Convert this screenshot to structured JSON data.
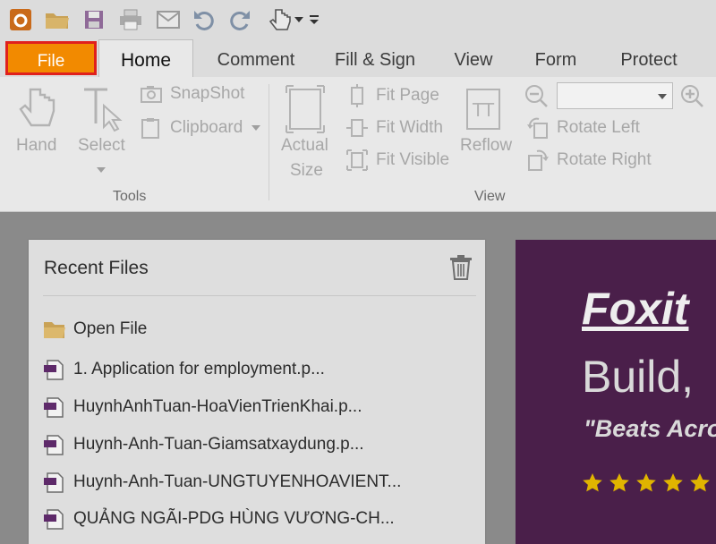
{
  "tabs": {
    "file": "File",
    "home": "Home",
    "comment": "Comment",
    "fill_sign": "Fill & Sign",
    "view": "View",
    "form": "Form",
    "protect": "Protect"
  },
  "ribbon": {
    "hand": "Hand",
    "select": "Select",
    "snapshot": "SnapShot",
    "clipboard": "Clipboard",
    "tools_group": "Tools",
    "actual_size_1": "Actual",
    "actual_size_2": "Size",
    "fit_page": "Fit Page",
    "fit_width": "Fit Width",
    "fit_visible": "Fit Visible",
    "reflow": "Reflow",
    "rotate_left": "Rotate Left",
    "rotate_right": "Rotate Right",
    "view_group": "View",
    "zoom_value": ""
  },
  "recent": {
    "title": "Recent Files",
    "open_file": "Open File",
    "files": [
      "1. Application for employment.p...",
      "HuynhAnhTuan-HoaVienTrienKhai.p...",
      "Huynh-Anh-Tuan-Giamsatxaydung.p...",
      "Huynh-Anh-Tuan-UNGTUYENHOAVIENT...",
      "QUẢNG NGÃI-PDG HÙNG VƯƠNG-CH..."
    ]
  },
  "promo": {
    "brand": "Foxit",
    "headline": "Build,",
    "quote": "\"Beats Acro"
  },
  "colors": {
    "file_tab": "#f28a00",
    "highlight_border": "#e0201c",
    "promo_bg": "#4a1f4a",
    "star": "#e0b400"
  }
}
